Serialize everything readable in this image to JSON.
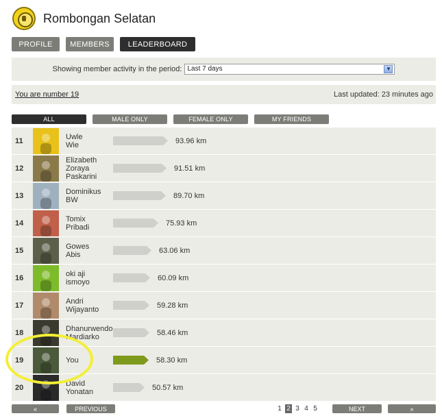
{
  "header": {
    "title": "Rombongan Selatan",
    "logo_icon": "club-emblem-icon"
  },
  "tabs": [
    {
      "label": "PROFILE",
      "active": false
    },
    {
      "label": "MEMBERS",
      "active": false
    },
    {
      "label": "LEADERBOARD",
      "active": true
    }
  ],
  "period": {
    "label": "Showing member activity in the period:",
    "selected": "Last 7 days"
  },
  "rank_info": {
    "you_are": "You are number 19",
    "last_updated": "Last updated: 23 minutes ago"
  },
  "filters": [
    {
      "label": "ALL",
      "active": true
    },
    {
      "label": "MALE ONLY",
      "active": false
    },
    {
      "label": "FEMALE ONLY",
      "active": false
    },
    {
      "label": "MY FRIENDS",
      "active": false
    }
  ],
  "leaderboard": [
    {
      "rank": "11",
      "name": [
        "Uwle",
        "Wie"
      ],
      "distance": "93.96 km",
      "km": 93.96,
      "is_you": false,
      "avatar_color": "#e8c21a"
    },
    {
      "rank": "12",
      "name": [
        "Elizabeth",
        "Zoraya",
        "Paskarini"
      ],
      "distance": "91.51 km",
      "km": 91.51,
      "is_you": false,
      "avatar_color": "#8a7a4a"
    },
    {
      "rank": "13",
      "name": [
        "Dominikus",
        "BW"
      ],
      "distance": "89.70 km",
      "km": 89.7,
      "is_you": false,
      "avatar_color": "#9fb0bf"
    },
    {
      "rank": "14",
      "name": [
        "Tomix",
        "Pribadi"
      ],
      "distance": "75.93 km",
      "km": 75.93,
      "is_you": false,
      "avatar_color": "#c0604a"
    },
    {
      "rank": "15",
      "name": [
        "Gowes",
        "Abis"
      ],
      "distance": "63.06 km",
      "km": 63.06,
      "is_you": false,
      "avatar_color": "#5c5f4a"
    },
    {
      "rank": "16",
      "name": [
        "oki aji",
        "ismoyo"
      ],
      "distance": "60.09 km",
      "km": 60.09,
      "is_you": false,
      "avatar_color": "#7dbb2a"
    },
    {
      "rank": "17",
      "name": [
        "Andri",
        "Wijayanto"
      ],
      "distance": "59.28 km",
      "km": 59.28,
      "is_you": false,
      "avatar_color": "#b08a6a"
    },
    {
      "rank": "18",
      "name": [
        "Dhanurwendo",
        "Mardiarko"
      ],
      "distance": "58.46 km",
      "km": 58.46,
      "is_you": false,
      "avatar_color": "#3a3a2e"
    },
    {
      "rank": "19",
      "name": [
        "You"
      ],
      "distance": "58.30 km",
      "km": 58.3,
      "is_you": true,
      "avatar_color": "#4a5a3a"
    },
    {
      "rank": "20",
      "name": [
        "David",
        "Yonatan"
      ],
      "distance": "50.57 km",
      "km": 50.57,
      "is_you": false,
      "avatar_color": "#2a2a2a"
    }
  ],
  "pagination": {
    "first": "«",
    "previous": "PREVIOUS",
    "pages": [
      "1",
      "2",
      "3",
      "4",
      "5"
    ],
    "current": "2",
    "next": "NEXT",
    "last": "»"
  },
  "colors": {
    "bar_default": "#cfcfcb",
    "bar_you": "#7e9a1d",
    "active_tab": "#2e2e2e",
    "inactive_tab": "#7d7d78",
    "highlight_ring": "#f3ee35"
  }
}
